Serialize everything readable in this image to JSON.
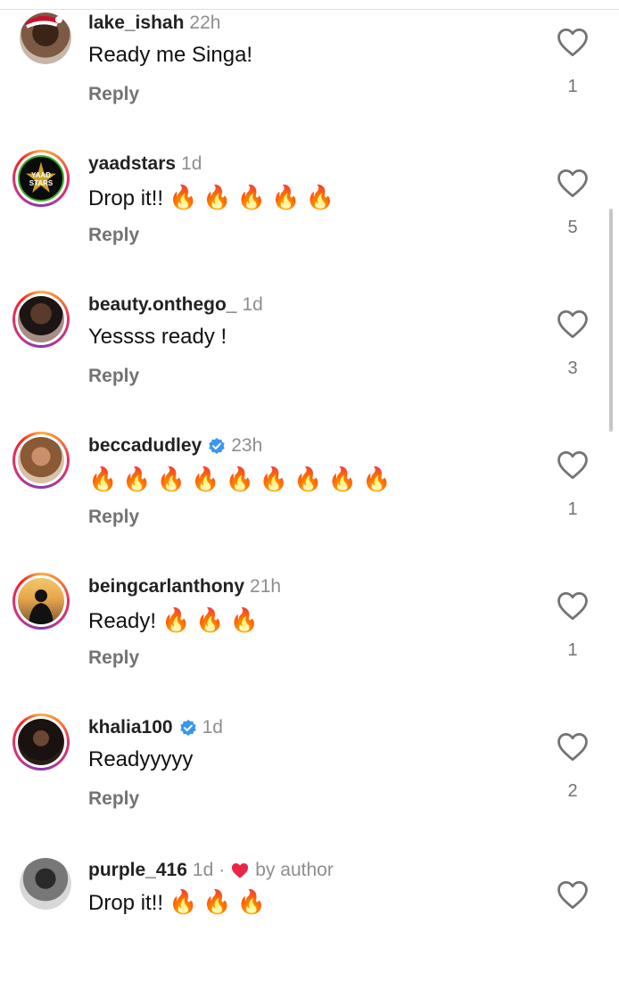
{
  "colors": {
    "verified": "#3897f0",
    "heart_red": "#ed2545",
    "muted": "#8e8e8e"
  },
  "comments": [
    {
      "username": "lake_ishah",
      "time": "22h",
      "text": "Ready me Singa!",
      "fires": 0,
      "reply": "Reply",
      "likes": "1",
      "verified": false,
      "avatar": "profile-photo-santa-hat"
    },
    {
      "username": "yaadstars",
      "time": "1d",
      "text": "Drop it!!",
      "fires": 5,
      "reply": "Reply",
      "likes": "5",
      "verified": false,
      "avatar": "YAAD STARS"
    },
    {
      "username": "beauty.onthego_",
      "time": "1d",
      "text": "Yessss ready !",
      "fires": 0,
      "reply": "Reply",
      "likes": "3",
      "verified": false,
      "avatar": "profile-photo"
    },
    {
      "username": "beccadudley",
      "time": "23h",
      "text": "",
      "fires": 9,
      "reply": "Reply",
      "likes": "1",
      "verified": true,
      "avatar": "profile-photo"
    },
    {
      "username": "beingcarlanthony",
      "time": "21h",
      "text": "Ready!",
      "fires": 3,
      "reply": "Reply",
      "likes": "1",
      "verified": false,
      "avatar": "silhouette-photo"
    },
    {
      "username": "khalia100",
      "time": "1d",
      "text": "Readyyyyy",
      "fires": 0,
      "reply": "Reply",
      "likes": "2",
      "verified": true,
      "avatar": "profile-photo"
    },
    {
      "username": "purple_416",
      "time": "1d",
      "separator": "·",
      "by_author": "by author",
      "text": "Drop it!!",
      "fires": 3,
      "reply": "",
      "likes": "",
      "verified": false,
      "avatar": "profile-photo-bw"
    }
  ],
  "fire_glyph": "🔥"
}
